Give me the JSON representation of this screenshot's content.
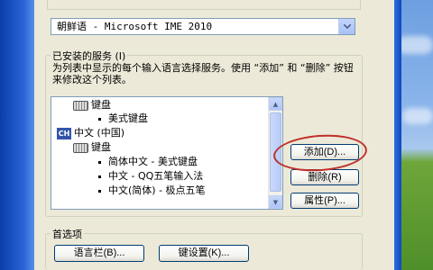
{
  "ime_select": {
    "value": "朝鲜语 - Microsoft IME 2010"
  },
  "installed_services": {
    "title": "已安装的服务 (I)",
    "description": "为列表中显示的每个输入语言选择服务。使用 “添加” 和 “删除” 按钮来修改这个列表。",
    "tree": [
      {
        "type": "category",
        "icon": "keyboard-icon",
        "label": "键盘"
      },
      {
        "type": "item",
        "label": "美式键盘"
      },
      {
        "type": "language",
        "icon": "ch-language-icon",
        "icon_text": "CH",
        "label": "中文 (中国)"
      },
      {
        "type": "category",
        "icon": "keyboard-icon",
        "label": "键盘"
      },
      {
        "type": "item",
        "label": "简体中文 - 美式键盘"
      },
      {
        "type": "item",
        "label": "中文 - QQ五笔输入法"
      },
      {
        "type": "item",
        "label": "中文(简体) - 极点五笔"
      }
    ]
  },
  "buttons": {
    "add": "添加(D)...",
    "remove": "删除(R)",
    "properties": "属性(P)..."
  },
  "preferences": {
    "title": "首选项",
    "language_bar": "语言栏(B)...",
    "key_settings": "键设置(K)..."
  },
  "colors": {
    "xp_blue": "#0b3ea8",
    "dialog_bg": "#ece9d8",
    "highlight_ellipse": "#c0302a"
  }
}
